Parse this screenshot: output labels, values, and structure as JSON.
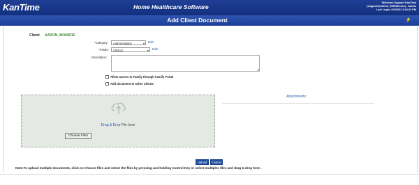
{
  "header": {
    "logo": "KanTime",
    "app_title": "Home Healthcare Software",
    "welcome": "Welcome Support KanTime",
    "account": "(support@Admin_999965.com) - Admin",
    "last_login": "Last Login: 6/3/2021 2:34:22 PM"
  },
  "page": {
    "title": "Add Client Document"
  },
  "form": {
    "client_label": "Client:",
    "client_name": "AARON, MONROE",
    "category_label": "*Category:",
    "category_value": "Authorizations",
    "folder_label": "*Folder:",
    "folder_value": "Clinical",
    "edit_label": "Edit",
    "description_label": "Description:",
    "description_value": "",
    "allow_family_label": "Allow access to Family through Family Portal",
    "add_other_clients_label": "Add document to Other Clients"
  },
  "upload": {
    "drag_drop": "Drag & Drop",
    "file_here": " File here",
    "choose_files": "Choose Files",
    "attachments_title": "Attachments:"
  },
  "actions": {
    "upload": "Upload",
    "cancel": "Cancel"
  },
  "note": "Note:To upload multiple documents, click on Choose files and select the files by pressing and holding Control Key or select multiples files and drag & drop here ."
}
